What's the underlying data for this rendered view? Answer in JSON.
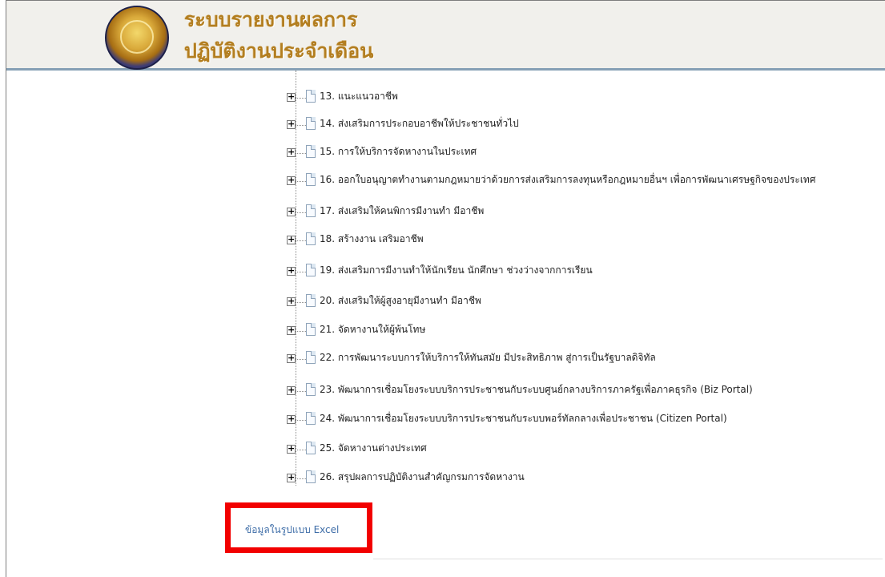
{
  "header": {
    "title_line1": "ระบบรายงานผลการ",
    "title_line2": "ปฏิบัติงานประจำเดือน"
  },
  "tree": {
    "expander_symbol": "+",
    "items": [
      {
        "label": "13. แนะแนวอาชีพ"
      },
      {
        "label": "14. ส่งเสริมการประกอบอาชีพให้ประชาชนทั่วไป"
      },
      {
        "label": "15. การให้บริการจัดหางานในประเทศ"
      },
      {
        "label": "16. ออกใบอนุญาตทำงานตามกฎหมายว่าด้วยการส่งเสริมการลงทุนหรือกฎหมายอื่นฯ เพื่อการพัฒนาเศรษฐกิจของประเทศ"
      },
      {
        "label": "17. ส่งเสริมให้คนพิการมีงานทำ มีอาชีพ"
      },
      {
        "label": "18. สร้างงาน เสริมอาชีพ"
      },
      {
        "label": "19. ส่งเสริมการมีงานทำให้นักเรียน นักศึกษา ช่วงว่างจากการเรียน"
      },
      {
        "label": "20. ส่งเสริมให้ผู้สูงอายุมีงานทำ มีอาชีพ"
      },
      {
        "label": "21. จัดหางานให้ผู้พ้นโทษ"
      },
      {
        "label": "22. การพัฒนาระบบการให้บริการให้ทันสมัย มีประสิทธิภาพ สู่การเป็นรัฐบาลดิจิทัล"
      },
      {
        "label": "23. พัฒนาการเชื่อมโยงระบบบริการประชาชนกับระบบศูนย์กลางบริการภาครัฐเพื่อภาคธุรกิจ (Biz Portal)"
      },
      {
        "label": "24. พัฒนาการเชื่อมโยงระบบบริการประชาชนกับระบบพอร์ทัลกลางเพื่อประชาชน (Citizen Portal)"
      },
      {
        "label": "25. จัดหางานต่างประเทศ"
      },
      {
        "label": "26. สรุปผลการปฏิบัติงานสำคัญกรมการจัดหางาน"
      }
    ]
  },
  "excel_link": {
    "label": "ข้อมูลในรูปแบบ Excel"
  },
  "colors": {
    "title_gold": "#b37e20",
    "header_bg": "#f1f0ec",
    "highlight_red": "#f20000",
    "link_blue": "#3f6ea8"
  }
}
